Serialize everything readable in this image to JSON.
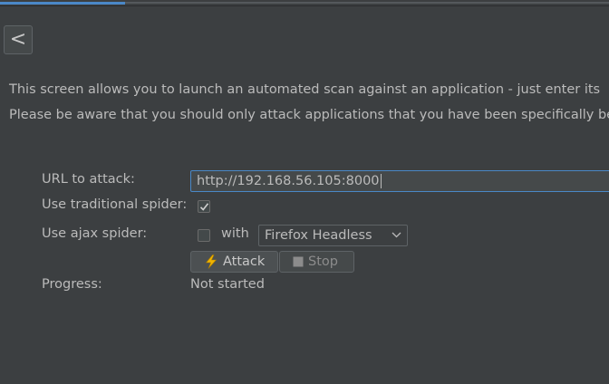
{
  "header": {
    "back_label": "<"
  },
  "intro": {
    "line1": "This screen allows you to launch an automated scan against  an application - just enter its",
    "line2": "Please be aware that you should only attack applications that you have been specifically be"
  },
  "form": {
    "url_label": "URL to attack:",
    "url_value": "http://192.168.56.105:8000",
    "traditional_spider_label": "Use traditional spider:",
    "traditional_spider_checked": true,
    "ajax_spider_label": "Use ajax spider:",
    "ajax_spider_checked": false,
    "with_label": "with",
    "browser_selected": "Firefox Headless",
    "attack_label": "Attack",
    "stop_label": "Stop",
    "progress_label": "Progress:",
    "progress_value": "Not started"
  },
  "colors": {
    "background": "#3c3f41",
    "text": "#bbbbbb",
    "accent": "#4a88c7",
    "attack_icon": "#f0b400"
  },
  "icons": {
    "back": "chevron-left-icon",
    "attack": "lightning-icon",
    "stop": "stop-square-icon",
    "dropdown": "chevron-down-icon",
    "check": "checkmark-icon"
  }
}
